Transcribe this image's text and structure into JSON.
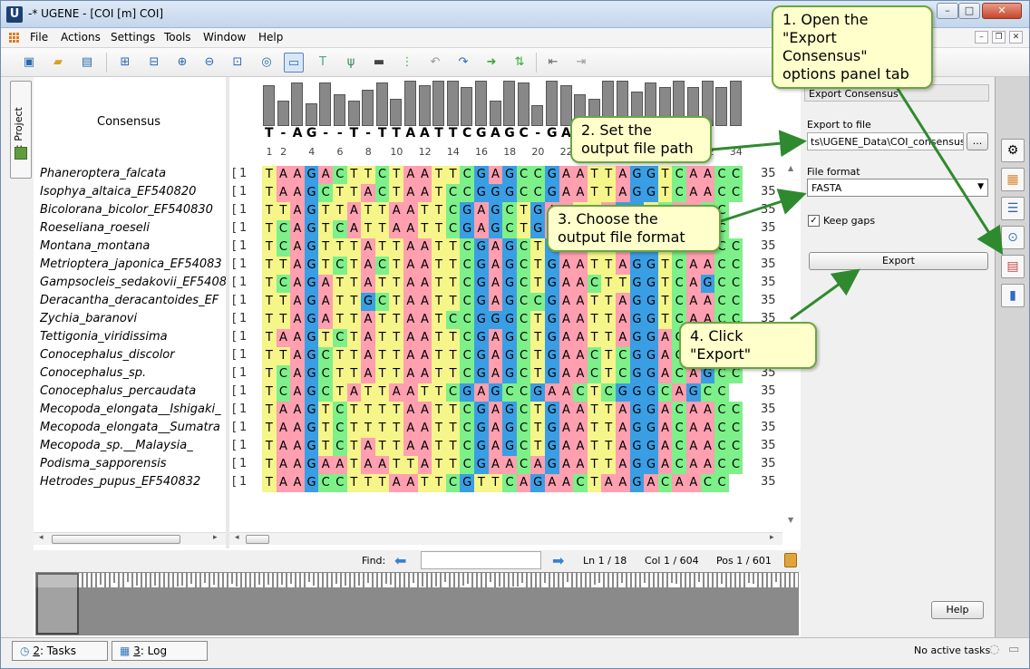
{
  "window": {
    "title": "-* UGENE - [COI [m] COI]",
    "app_icon": "U"
  },
  "menu": [
    "File",
    "Actions",
    "Settings",
    "Tools",
    "Window",
    "Help"
  ],
  "toolbar_icons": [
    "new-project-icon",
    "open-icon",
    "save-icon",
    "add-sequence-icon",
    "insert-icon",
    "zoom-in-icon",
    "zoom-out-icon",
    "zoom-fit-icon",
    "zoom-reset-icon",
    "show-overview-icon",
    "text-mode-icon",
    "tree-icon",
    "capture-icon",
    "sort-icon",
    "undo-icon",
    "redo-icon",
    "go-right-icon",
    "collapse-icon",
    "shift-left-icon",
    "shift-right-icon"
  ],
  "project_tab": {
    "label": "1: Project"
  },
  "alignment": {
    "consensus_label": "Consensus",
    "consensus": "T-AG--T-TTAATTCGAGC-GA-CTCAGGACC",
    "ruler": [
      "1",
      "2",
      "4",
      "6",
      "8",
      "10",
      "12",
      "14",
      "16",
      "18",
      "20",
      "22",
      "24",
      "26",
      "28",
      "30",
      "32",
      "34"
    ],
    "rows": [
      {
        "name": "Phaneroptera_falcata",
        "seq": "TAAGACTTCTAATTCGAGCCGAATTAGGTCAACC",
        "end": "35"
      },
      {
        "name": "Isophya_altaica_EF540820",
        "seq": "TAAGCTTACTAATCCGGGCCGAATTAGGTCAACC",
        "end": "35"
      },
      {
        "name": "Bicolorana_bicolor_EF540830",
        "seq": "TTAGTTATTAATTCGAGCTGAATTAGGTCAACC",
        "end": "35"
      },
      {
        "name": "Roeseliana_roeseli",
        "seq": "TCAGTCATTAATTCGAGCTGAATTAGGTCAACC",
        "end": "35"
      },
      {
        "name": "Montana_montana",
        "seq": "TCAGTTTATTAATTCGAGCTGAATTAGGTCAACC",
        "end": "35"
      },
      {
        "name": "Metrioptera_japonica_EF54083",
        "seq": "TTAGTCTACTAATTCGAGCTGAATTAGGTCAACC",
        "end": "35"
      },
      {
        "name": "Gampsocleis_sedakovii_EF5408",
        "seq": "TCAGATTATTAATTCGAGCTGAACTTGGTCAGCC",
        "end": "35"
      },
      {
        "name": "Deracantha_deracantoides_EF",
        "seq": "TTAGATTGCTAATTCGAGCCGAATTAGGTCAACC",
        "end": "35"
      },
      {
        "name": "Zychia_baranovi",
        "seq": "TTAGATTATTAATCCGGGCTGAATTAGGTCAACC",
        "end": "35"
      },
      {
        "name": "Tettigonia_viridissima",
        "seq": "TAAGTCTATTAATTCGAGCTGAATTAGGACAACC",
        "end": "35"
      },
      {
        "name": "Conocephalus_discolor",
        "seq": "TTAGCTTATTAATTCGAGCTGAACTCGGACAACC",
        "end": "35"
      },
      {
        "name": "Conocephalus_sp.",
        "seq": "TCAGCTTATTAATTCGAGCTGAACTCGGACAGCC",
        "end": "35"
      },
      {
        "name": "Conocephalus_percaudata",
        "seq": "TCAGCTATTAATTCGAGCCGAACTCGGGCAGCC",
        "end": "35"
      },
      {
        "name": "Mecopoda_elongata__Ishigaki_",
        "seq": "TAAGTCTTTTAATTCGAGCTGAATTAGGACAACC",
        "end": "35"
      },
      {
        "name": "Mecopoda_elongata__Sumatra",
        "seq": "TAAGTCTTTTAATTCGAGCTGAATTAGGACAACC",
        "end": "35"
      },
      {
        "name": "Mecopoda_sp.__Malaysia_",
        "seq": "TAAGTCTATTAATTCGAGCTGAATTAGGACAACC",
        "end": "35"
      },
      {
        "name": "Podisma_sapporensis",
        "seq": "TAAGAATAATTATTCGAACAGAATTAGGACAACC",
        "end": "35"
      },
      {
        "name": "Hetrodes_pupus_EF540832",
        "seq": "TAAGCCTTTAATTCGTTCAGAACTAAGACAACC",
        "end": "35"
      }
    ]
  },
  "histogram": [
    0.9,
    0.55,
    0.95,
    0.5,
    0.95,
    0.7,
    0.55,
    0.8,
    0.95,
    0.6,
    1,
    0.9,
    1,
    1,
    0.85,
    1,
    0.55,
    1,
    0.95,
    0.45,
    1,
    0.9,
    0.7,
    0.6,
    1,
    1,
    0.75,
    0.95,
    0.85,
    1,
    0.85,
    1,
    0.85,
    1
  ],
  "findbar": {
    "find_label": "Find:",
    "ln": "Ln 1 / 18",
    "col": "Col 1 / 604",
    "pos": "Pos 1 / 601"
  },
  "options_panel": {
    "header": "Export Consensus",
    "export_to_file_label": "Export to file",
    "path": "ts\\UGENE_Data\\COI_consensus.fa",
    "browse_label": "...",
    "file_format_label": "File format",
    "file_format_value": "FASTA",
    "keep_gaps_label": "Keep gaps",
    "keep_gaps_checked": true,
    "export_button": "Export",
    "help_button": "Help"
  },
  "right_tabs": [
    "general-icon",
    "highlighting-icon",
    "pairwise-icon",
    "export-consensus-icon",
    "statistics-icon",
    "tree-settings-icon"
  ],
  "bottom": {
    "tasks_num": "2",
    "tasks_label": ": Tasks",
    "log_num": "3",
    "log_label": ": Log",
    "status": "No active tasks"
  },
  "callouts": {
    "c1": "1. Open the \"Export Consensus\" options panel tab",
    "c2": "2. Set the output file path",
    "c3": "3. Choose the output file format",
    "c4": "4. Click \"Export\""
  },
  "colors": {
    "A": "#ff9fb0",
    "C": "#7df08a",
    "G": "#3a9ee4",
    "T": "#f5f58a",
    "accent": "#6aa542",
    "callout_bg": "#ffffcc"
  }
}
